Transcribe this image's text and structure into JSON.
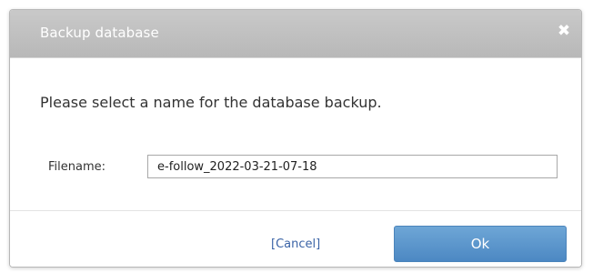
{
  "dialog": {
    "title": "Backup database",
    "close_icon": "close-icon",
    "message": "Please select a name for the database backup.",
    "filename_label": "Filename:",
    "filename_value": "e-follow_2022-03-21-07-18",
    "cancel_label": "[Cancel]",
    "ok_label": "Ok"
  },
  "colors": {
    "titlebar": "#bdbdbd",
    "ok_button": "#5d97cf",
    "cancel_link": "#3a63a6"
  }
}
